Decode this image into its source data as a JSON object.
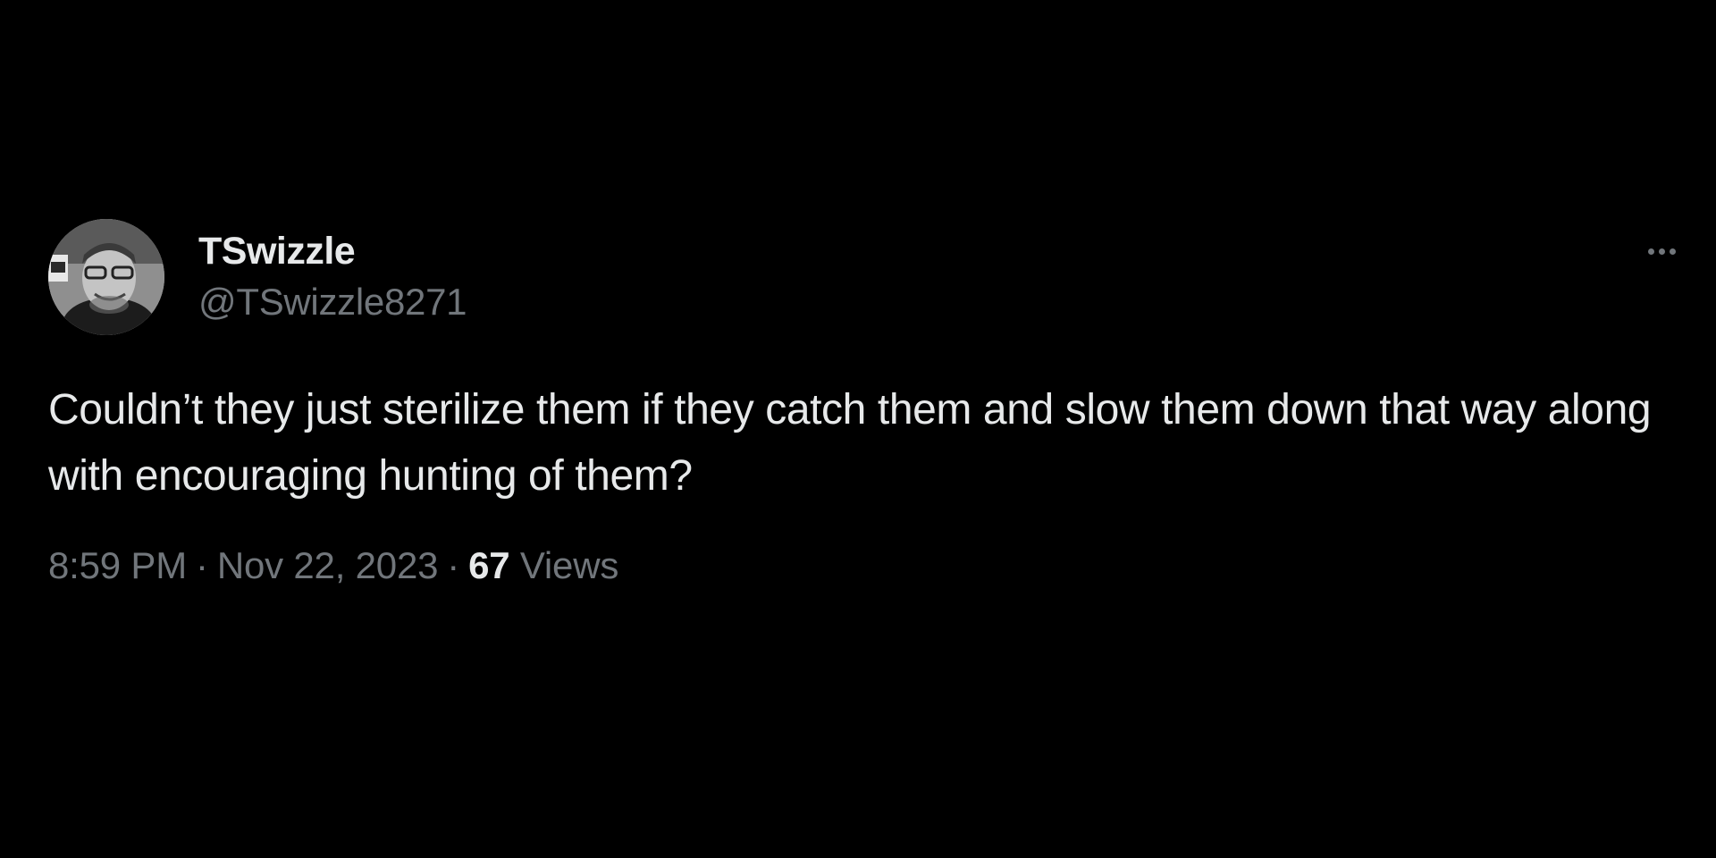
{
  "author": {
    "display_name": "TSwizzle",
    "handle": "@TSwizzle8271",
    "avatar_icon": "user-avatar-photo"
  },
  "more_icon": "more-options-icon",
  "tweet": {
    "text": "Couldn’t they just sterilize them if they catch them and slow them down that way along with encouraging hunting of them?"
  },
  "meta": {
    "time": "8:59 PM",
    "separator": "·",
    "date": "Nov 22, 2023",
    "views_count": "67",
    "views_label": "Views"
  },
  "colors": {
    "background": "#000000",
    "primary_text": "#e7e9ea",
    "secondary_text": "#71767b"
  }
}
